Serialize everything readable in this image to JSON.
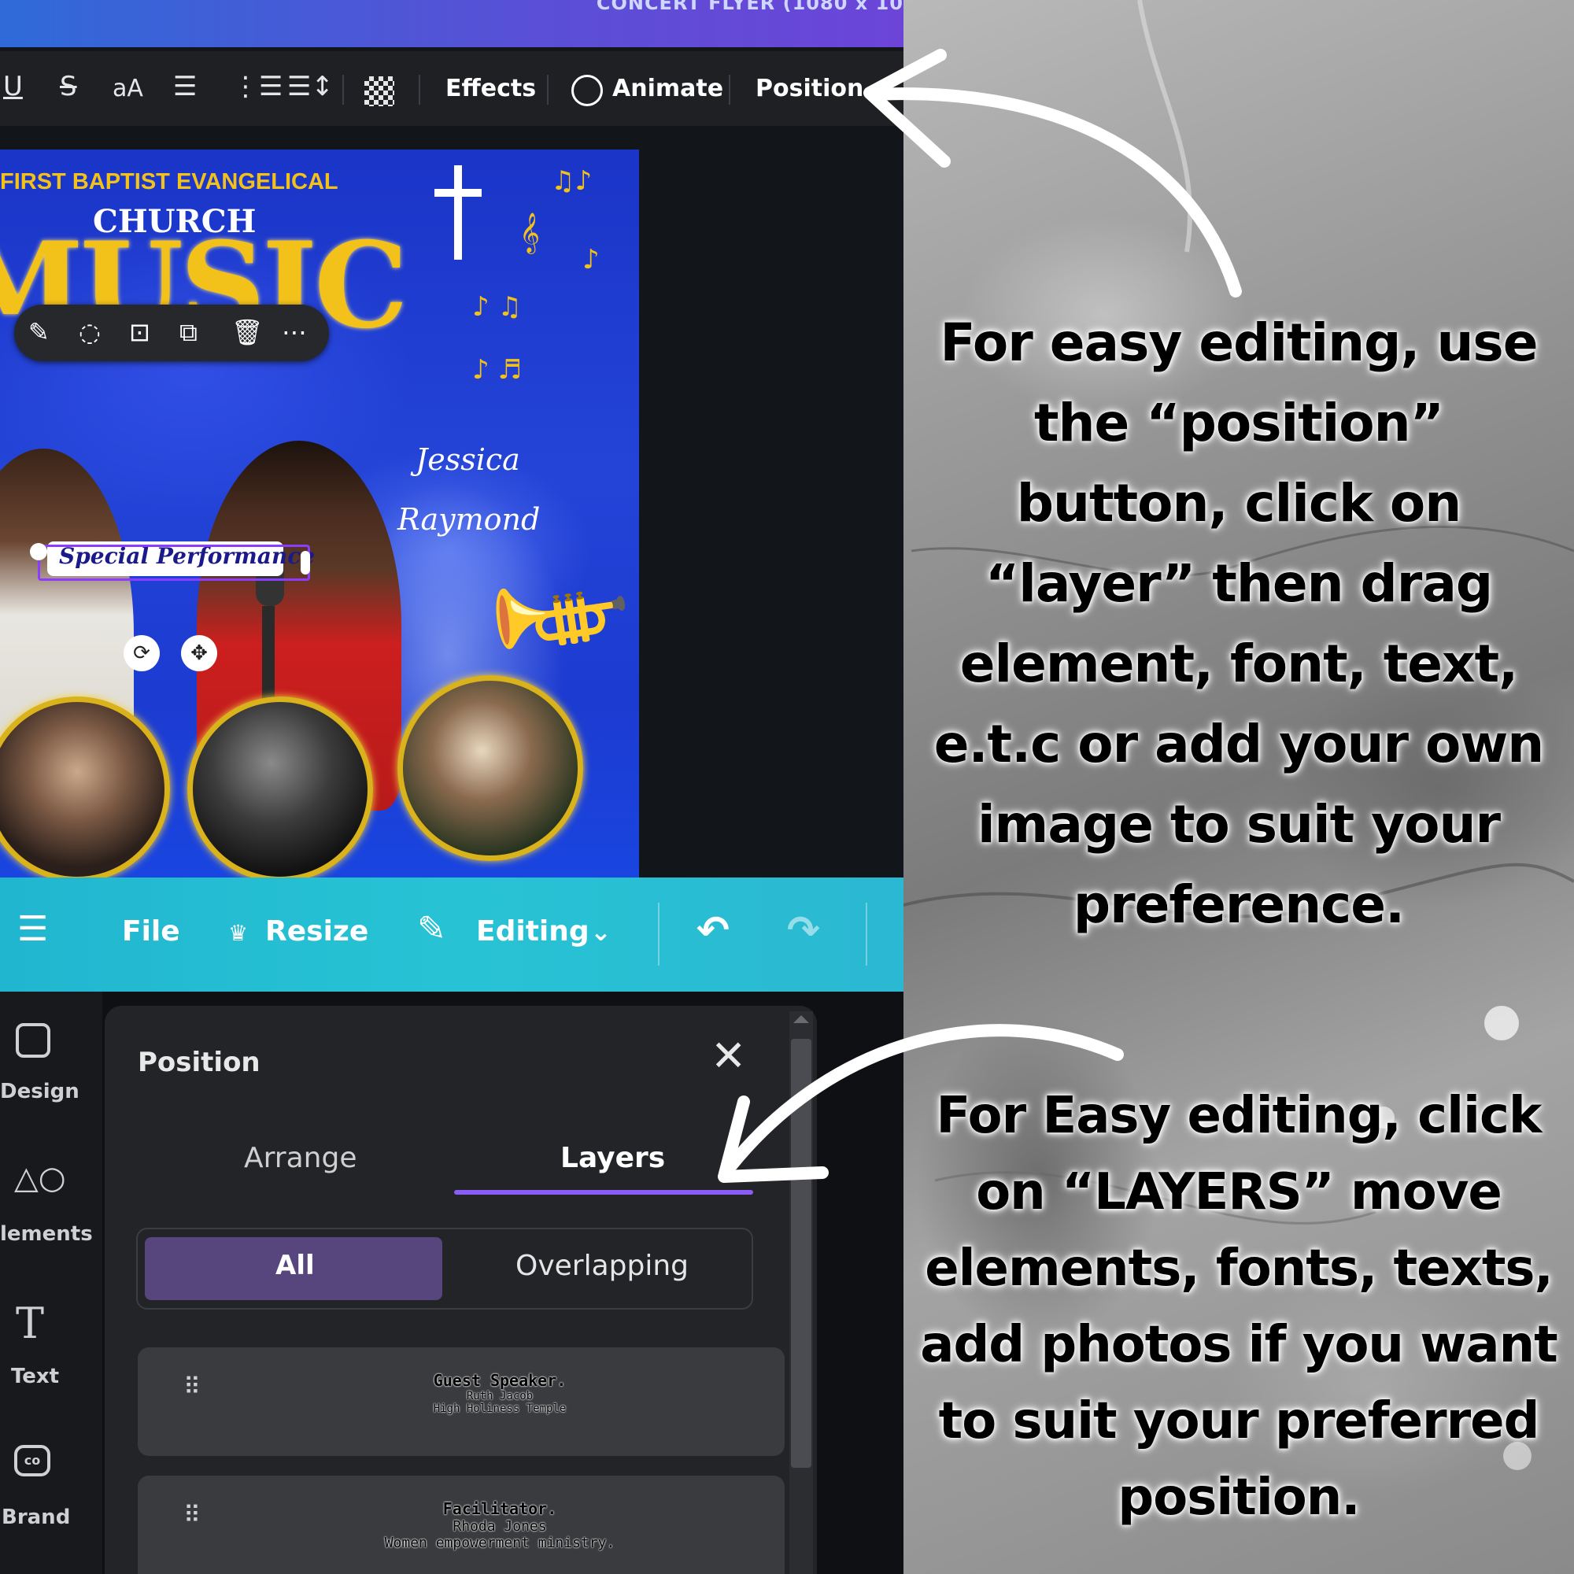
{
  "top_window": {
    "title": "CONCERT FLYER (1080 x 10",
    "format_bar": {
      "underline": "U",
      "strike": "S",
      "case": "aA",
      "effects": "Effects",
      "animate": "Animate",
      "position": "Position"
    },
    "flyer": {
      "org_line": "FIRST BAPTIST EVANGELICAL",
      "church": "CHURCH",
      "music": "MUSIC",
      "subtitle": "Special Performance",
      "name1": "Jessica",
      "name2": "Raymond"
    },
    "element_toolbar": [
      "magic-edit-icon",
      "comment-icon",
      "lock-icon",
      "duplicate-icon",
      "delete-icon",
      "more-icon"
    ]
  },
  "editor_bar": {
    "menu_icon": "hamburger-icon",
    "file": "File",
    "resize": "Resize",
    "editing": "Editing",
    "undo": "undo-icon",
    "redo": "redo-icon"
  },
  "sidebar": {
    "items": [
      {
        "label": "Design",
        "icon": "design-icon"
      },
      {
        "label": "lements",
        "icon": "elements-icon"
      },
      {
        "label": "Text",
        "icon": "text-icon"
      },
      {
        "label": "Brand",
        "icon": "brand-icon"
      }
    ]
  },
  "position_panel": {
    "title": "Position",
    "tabs": [
      "Arrange",
      "Layers"
    ],
    "active_tab": "Layers",
    "segments": [
      "All",
      "Overlapping"
    ],
    "active_segment": "All",
    "layers": [
      {
        "lines": [
          "Guest Speaker.",
          "Ruth Jacob",
          "High Holiness Temple"
        ]
      },
      {
        "lines": [
          "Facilitator.",
          "Rhoda Jones",
          "Women empowerment ministry."
        ]
      }
    ]
  },
  "instructions": {
    "top": [
      "For easy editing, use",
      "the “position”",
      "button, click on",
      "“layer” then drag",
      "element, font, text,",
      "e.t.c  or add your own",
      "image to suit your",
      "preference."
    ],
    "bottom": [
      "For Easy editing, click",
      "on “LAYERS” move",
      "elements, fonts, texts,",
      "add photos if you want",
      "to suit your preferred",
      "position."
    ]
  },
  "colors": {
    "accent_purple": "#8b5cf6",
    "cyan_bar": "#27c3d4",
    "flyer_blue": "#2444d8",
    "gold": "#f2c21a"
  }
}
